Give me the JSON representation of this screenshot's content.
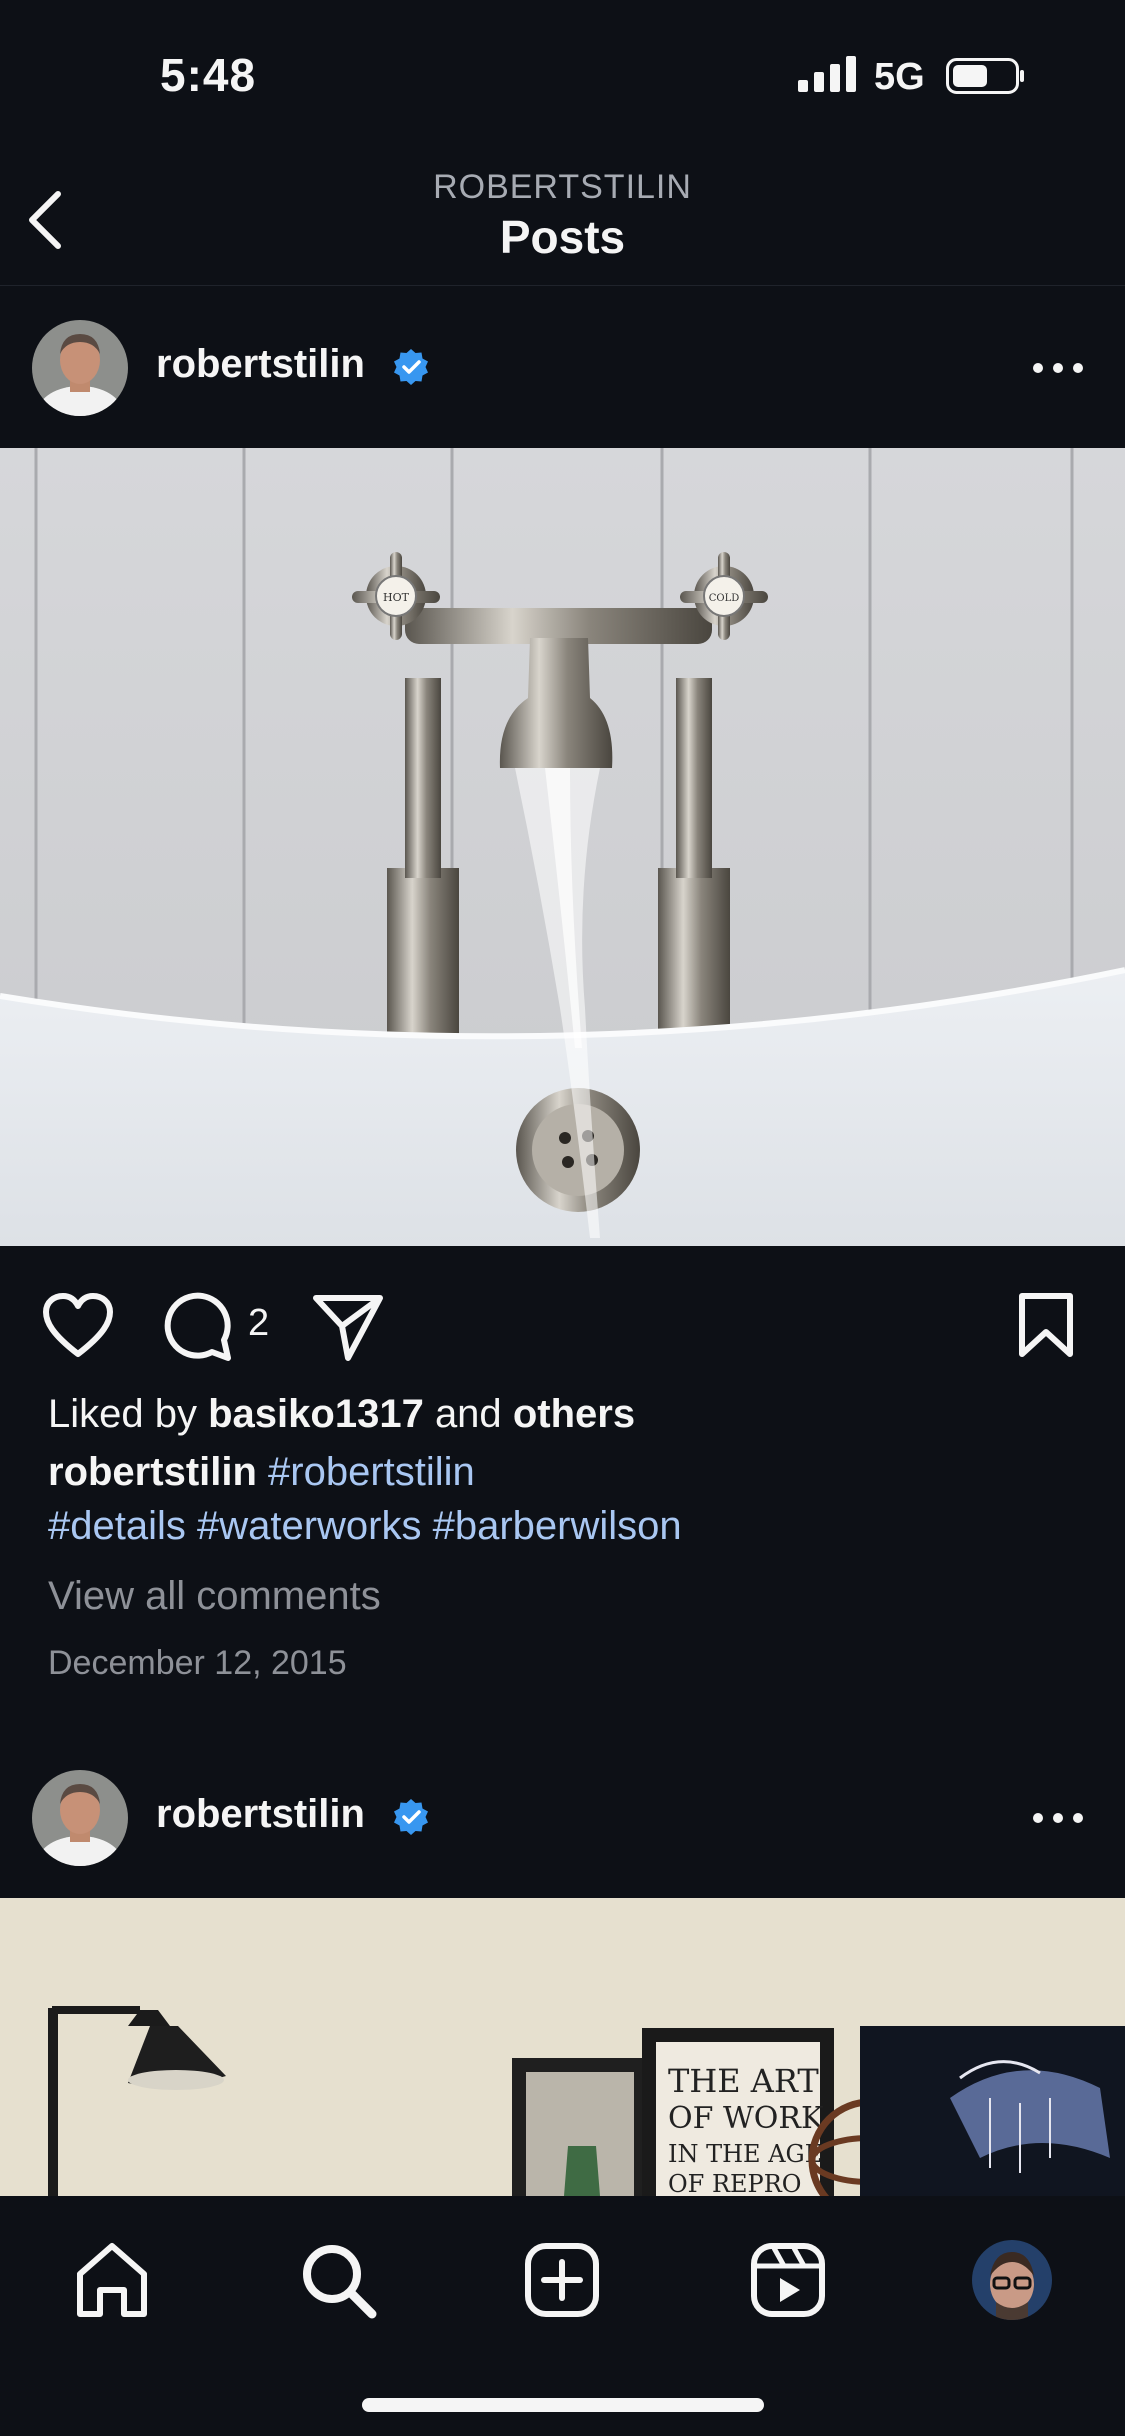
{
  "status": {
    "time": "5:48",
    "network": "5G"
  },
  "header": {
    "username_caps": "ROBERTSTILIN",
    "title": "Posts"
  },
  "posts": [
    {
      "username": "robertstilin",
      "comments_count": "2",
      "liked_prefix": "Liked by",
      "liked_user": "basiko1317",
      "liked_and": "and",
      "liked_others": "others",
      "caption_user": "robertstilin",
      "hashtags_line1": "#robertstilin",
      "hashtags_line2": "#details #waterworks #barberwilson",
      "view_comments": "View all comments",
      "date": "December 12, 2015",
      "faucet_labels": {
        "hot": "HOT",
        "cold": "COLD"
      }
    },
    {
      "username": "robertstilin",
      "poster_text": [
        "THE ART",
        "OF WORK",
        "IN THE AGE",
        "OF REPRO"
      ]
    }
  ],
  "colors": {
    "background": "#0d1016",
    "verified": "#3897f0",
    "hashtag": "#a9c7f2",
    "muted": "#8e9198"
  },
  "icons": [
    "back-chevron-icon",
    "verified-badge-icon",
    "more-dots-icon",
    "heart-icon",
    "comment-icon",
    "share-icon",
    "bookmark-icon",
    "home-icon",
    "search-icon",
    "create-icon",
    "reels-icon",
    "profile-avatar"
  ]
}
